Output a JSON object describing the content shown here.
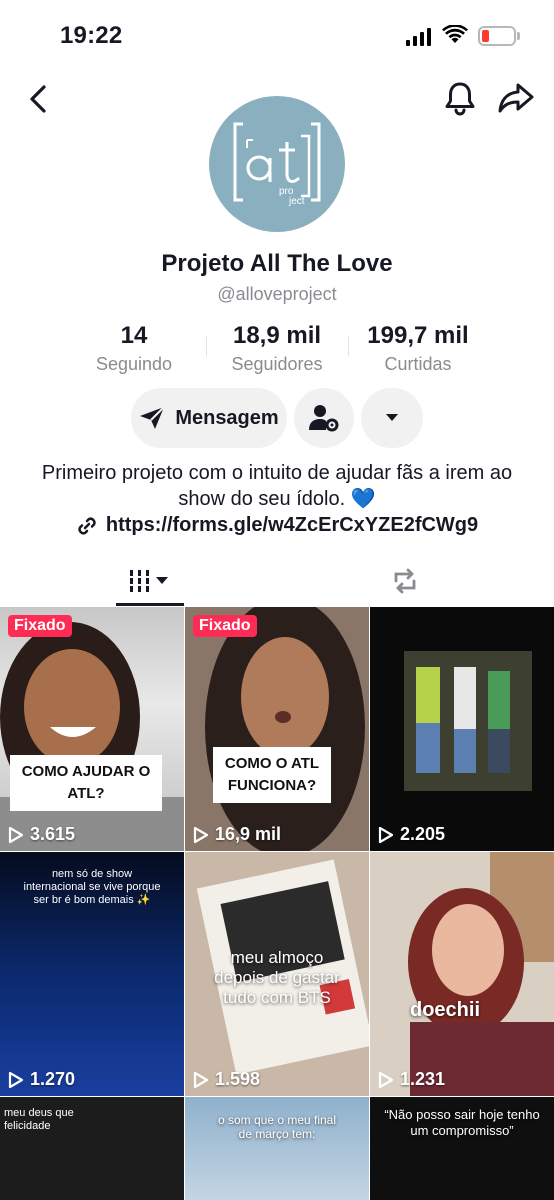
{
  "status_bar": {
    "time": "19:22"
  },
  "profile": {
    "display_name": "Projeto All The Love",
    "username": "@alloveproject",
    "avatar_text": "ATL project",
    "stats": [
      {
        "value": "14",
        "label": "Seguindo"
      },
      {
        "value": "18,9 mil",
        "label": "Seguidores"
      },
      {
        "value": "199,7 mil",
        "label": "Curtidas"
      }
    ],
    "message_label": "Mensagem",
    "bio": "Primeiro projeto com o intuito de ajudar fãs a irem ao show do seu ídolo. 💙",
    "link": "https://forms.gle/w4ZcErCxYZE2fCWg9"
  },
  "videos": [
    {
      "pinned_label": "Fixado",
      "views": "3.615",
      "caption": "COMO AJUDAR O ATL?"
    },
    {
      "pinned_label": "Fixado",
      "views": "16,9 mil",
      "caption": "COMO O ATL FUNCIONA?"
    },
    {
      "views": "2.205"
    },
    {
      "views": "1.270",
      "caption": "nem só de show internacional se vive porque ser br é bom demais ✨"
    },
    {
      "views": "1.598",
      "caption": "meu almoço depois de gastar tudo com BTS"
    },
    {
      "views": "1.231",
      "caption": "doechii"
    },
    {
      "caption": "meu deus que felicidade"
    },
    {
      "caption": "o som que o meu final de março tem:"
    },
    {
      "caption": "“Não posso sair hoje tenho um compromisso”"
    }
  ],
  "colors": {
    "accent": "#fe2c55",
    "avatar_bg": "#8ab0bf",
    "link_heart": "#3a8ee6"
  }
}
